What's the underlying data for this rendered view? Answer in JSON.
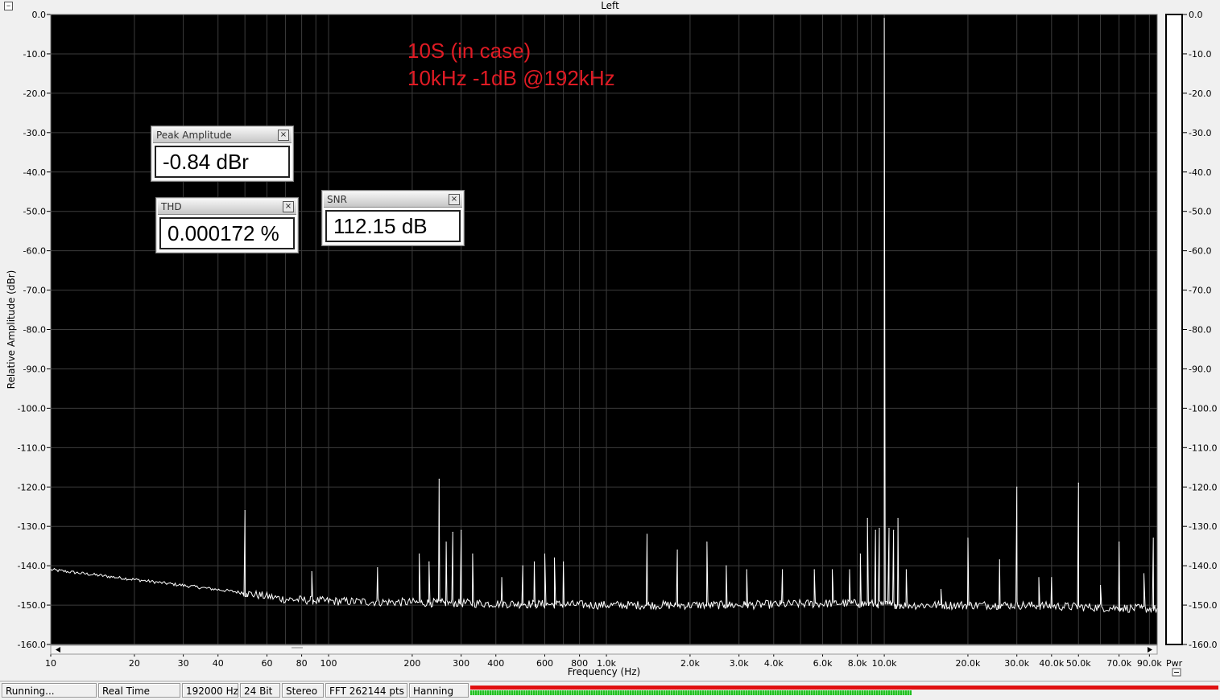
{
  "window": {
    "title": "Left"
  },
  "chart_data": {
    "type": "line",
    "xscale": "log",
    "xlim": [
      10,
      96000
    ],
    "ylim": [
      -160,
      0
    ],
    "grid": true,
    "background": "#000000",
    "line_color": "#ffffff",
    "xlabel": "Frequency (Hz)",
    "ylabel": "Relative Amplitude (dBr)",
    "x_ticks": [
      {
        "v": 10,
        "label": "10"
      },
      {
        "v": 20,
        "label": "20"
      },
      {
        "v": 30,
        "label": "30"
      },
      {
        "v": 40,
        "label": "40"
      },
      {
        "v": 60,
        "label": "60"
      },
      {
        "v": 80,
        "label": "80"
      },
      {
        "v": 100,
        "label": "100"
      },
      {
        "v": 200,
        "label": "200"
      },
      {
        "v": 300,
        "label": "300"
      },
      {
        "v": 400,
        "label": "400"
      },
      {
        "v": 600,
        "label": "600"
      },
      {
        "v": 800,
        "label": "800"
      },
      {
        "v": 1000,
        "label": "1.0k"
      },
      {
        "v": 2000,
        "label": "2.0k"
      },
      {
        "v": 3000,
        "label": "3.0k"
      },
      {
        "v": 4000,
        "label": "4.0k"
      },
      {
        "v": 6000,
        "label": "6.0k"
      },
      {
        "v": 8000,
        "label": "8.0k"
      },
      {
        "v": 10000,
        "label": "10.0k"
      },
      {
        "v": 20000,
        "label": "20.0k"
      },
      {
        "v": 30000,
        "label": "30.0k"
      },
      {
        "v": 40000,
        "label": "40.0k"
      },
      {
        "v": 50000,
        "label": "50.0k"
      },
      {
        "v": 70000,
        "label": "70.0k"
      },
      {
        "v": 90000,
        "label": "90.0k"
      }
    ],
    "y_ticks": [
      {
        "v": 0,
        "label": "0.0"
      },
      {
        "v": -10,
        "label": "-10.0"
      },
      {
        "v": -20,
        "label": "-20.0"
      },
      {
        "v": -30,
        "label": "-30.0"
      },
      {
        "v": -40,
        "label": "-40.0"
      },
      {
        "v": -50,
        "label": "-50.0"
      },
      {
        "v": -60,
        "label": "-60.0"
      },
      {
        "v": -70,
        "label": "-70.0"
      },
      {
        "v": -80,
        "label": "-80.0"
      },
      {
        "v": -90,
        "label": "-90.0"
      },
      {
        "v": -100,
        "label": "-100.0"
      },
      {
        "v": -110,
        "label": "-110.0"
      },
      {
        "v": -120,
        "label": "-120.0"
      },
      {
        "v": -130,
        "label": "-130.0"
      },
      {
        "v": -140,
        "label": "-140.0"
      },
      {
        "v": -150,
        "label": "-150.0"
      },
      {
        "v": -160,
        "label": "-160.0"
      }
    ],
    "noise_floor": [
      [
        10,
        -141
      ],
      [
        20,
        -143.5
      ],
      [
        30,
        -145
      ],
      [
        45,
        -146.5
      ],
      [
        70,
        -148.5
      ],
      [
        100,
        -149
      ],
      [
        300,
        -149.5
      ],
      [
        1000,
        -150
      ],
      [
        3000,
        -150
      ],
      [
        7000,
        -149.5
      ],
      [
        12000,
        -150
      ],
      [
        30000,
        -150
      ],
      [
        96000,
        -151
      ]
    ],
    "peaks": [
      [
        50,
        -126
      ],
      [
        87,
        -141.5
      ],
      [
        150,
        -140.5
      ],
      [
        212,
        -137
      ],
      [
        230,
        -139
      ],
      [
        250,
        -118
      ],
      [
        265,
        -134
      ],
      [
        280,
        -131.5
      ],
      [
        300,
        -131
      ],
      [
        330,
        -137
      ],
      [
        420,
        -143
      ],
      [
        500,
        -140
      ],
      [
        550,
        -139
      ],
      [
        600,
        -137
      ],
      [
        650,
        -138
      ],
      [
        700,
        -139
      ],
      [
        1400,
        -132
      ],
      [
        1800,
        -136
      ],
      [
        2300,
        -134
      ],
      [
        2700,
        -140
      ],
      [
        3200,
        -141
      ],
      [
        4300,
        -141
      ],
      [
        5600,
        -141
      ],
      [
        6500,
        -141
      ],
      [
        7500,
        -141
      ],
      [
        8200,
        -137
      ],
      [
        8700,
        -128
      ],
      [
        9300,
        -131
      ],
      [
        9600,
        -130.5
      ],
      [
        10000,
        -1
      ],
      [
        10400,
        -130.5
      ],
      [
        10800,
        -131
      ],
      [
        11200,
        -128
      ],
      [
        12000,
        -141
      ],
      [
        16000,
        -146
      ],
      [
        20000,
        -133
      ],
      [
        26000,
        -138.5
      ],
      [
        30000,
        -120
      ],
      [
        36000,
        -143
      ],
      [
        40000,
        -143
      ],
      [
        50000,
        -119
      ],
      [
        60000,
        -145
      ],
      [
        70000,
        -134
      ],
      [
        86000,
        -142
      ],
      [
        93000,
        -133
      ]
    ],
    "annotations": [
      "10S (in case)",
      "10kHz -1dB @192kHz"
    ],
    "right_axis_extra": "Pwr"
  },
  "meters": {
    "peak": {
      "title": "Peak Amplitude",
      "value": "-0.84 dBr"
    },
    "thd": {
      "title": "THD",
      "value": "0.000172 %"
    },
    "snr": {
      "title": "SNR",
      "value": "112.15 dB"
    },
    "close_glyph": "×"
  },
  "status": {
    "state": "Running...",
    "mode": "Real Time",
    "sample_rate": "192000 Hz",
    "bits": "24 Bit",
    "channels": "Stereo",
    "fft": "FFT 262144 pts",
    "window": "Hanning"
  },
  "level_meter": {
    "top_fill": 1.0,
    "bottom_fill": 0.59,
    "top_color": "#e01010",
    "bottom_color": "#22c022"
  }
}
